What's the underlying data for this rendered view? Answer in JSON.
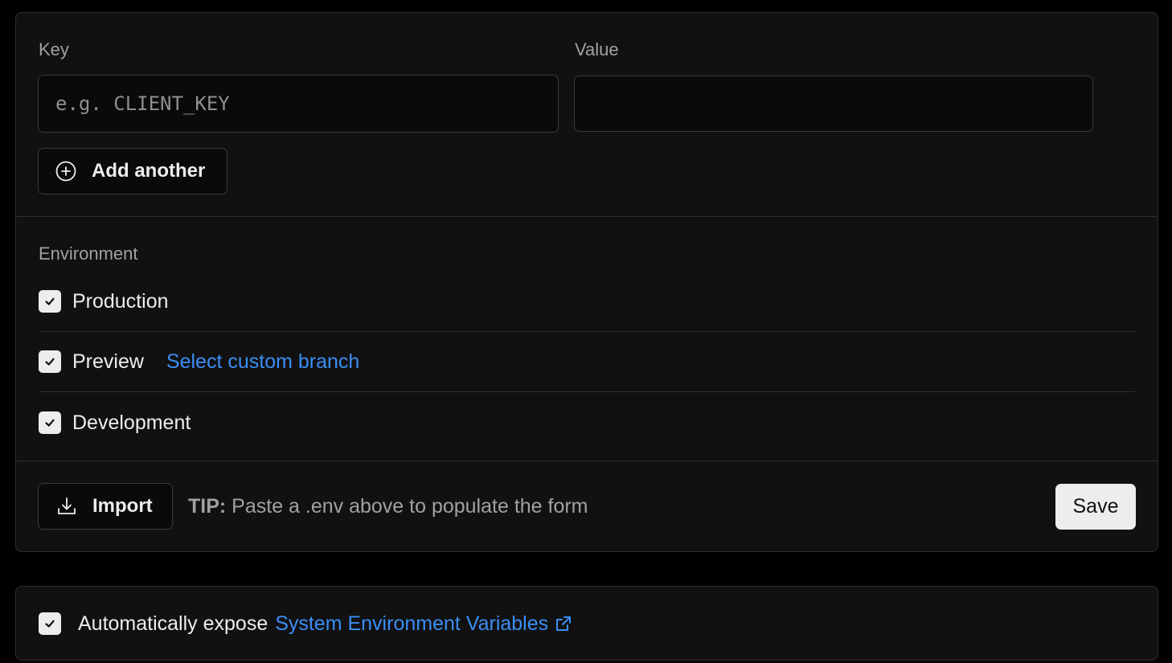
{
  "form": {
    "key_label": "Key",
    "key_placeholder": "e.g. CLIENT_KEY",
    "key_value": "",
    "value_label": "Value",
    "value_value": "",
    "add_another_label": "Add another"
  },
  "environment": {
    "label": "Environment",
    "options": [
      {
        "label": "Production",
        "checked": true
      },
      {
        "label": "Preview",
        "checked": true,
        "link": "Select custom branch"
      },
      {
        "label": "Development",
        "checked": true
      }
    ]
  },
  "footer": {
    "import_label": "Import",
    "tip_prefix": "TIP:",
    "tip_text": " Paste a .env above to populate the form",
    "save_label": "Save"
  },
  "expose": {
    "checked": true,
    "text": "Automatically expose ",
    "link": "System Environment Variables",
    "icon": "external-link-icon"
  },
  "colors": {
    "background": "#000000",
    "card": "#111111",
    "border": "#2e2e2e",
    "text": "#ededed",
    "muted": "#a1a1a1",
    "link": "#3b8ef5"
  }
}
